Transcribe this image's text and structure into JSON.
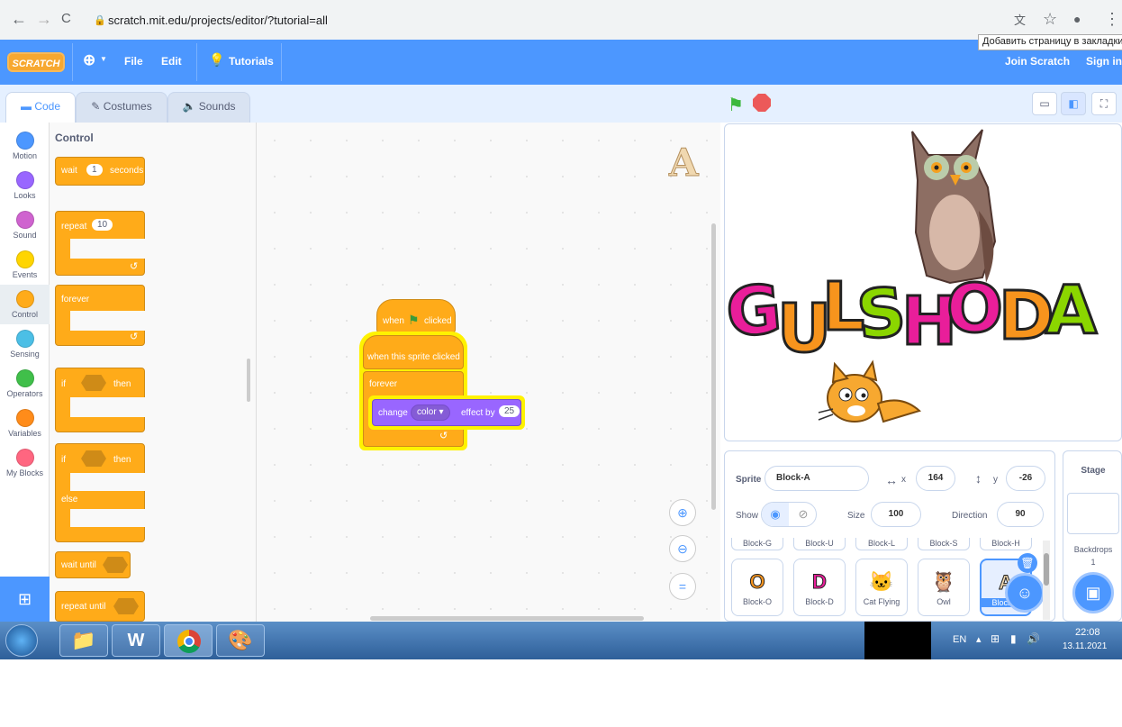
{
  "browser": {
    "url": "scratch.mit.edu/projects/editor/?tutorial=all",
    "tooltip": "Добавить страницу в закладки",
    "back_icon": "←",
    "forward_icon": "→",
    "reload_icon": "C"
  },
  "menubar": {
    "logo": "SCRATCH",
    "file": "File",
    "edit": "Edit",
    "tutorials": "Tutorials",
    "join": "Join Scratch",
    "signin": "Sign in"
  },
  "tabs": {
    "code": "Code",
    "costumes": "Costumes",
    "sounds": "Sounds"
  },
  "categories": [
    {
      "label": "Motion",
      "color": "#4c97ff"
    },
    {
      "label": "Looks",
      "color": "#9966ff"
    },
    {
      "label": "Sound",
      "color": "#cf63cf"
    },
    {
      "label": "Events",
      "color": "#ffd500"
    },
    {
      "label": "Control",
      "color": "#ffab19"
    },
    {
      "label": "Sensing",
      "color": "#4cbfe6"
    },
    {
      "label": "Operators",
      "color": "#40bf4a"
    },
    {
      "label": "Variables",
      "color": "#ff8c1a"
    },
    {
      "label": "My Blocks",
      "color": "#ff6680"
    }
  ],
  "palette": {
    "heading": "Control",
    "wait": "wait",
    "wait_value": "1",
    "seconds": "seconds",
    "repeat": "repeat",
    "repeat_value": "10",
    "forever": "forever",
    "if": "if",
    "then": "then",
    "if2": "if",
    "then2": "then",
    "else": "else",
    "wait_until": "wait until",
    "repeat_until": "repeat until"
  },
  "script": {
    "when": "when",
    "clicked": "clicked",
    "when_sprite_clicked": "when this sprite clicked",
    "forever": "forever",
    "change": "change",
    "effect_option": "color",
    "effect_by": "effect by",
    "effect_value": "25"
  },
  "stage": {
    "title_text": "GULSHODA"
  },
  "sprite_info": {
    "sprite_label": "Sprite",
    "sprite_name": "Block-A",
    "x_label": "x",
    "x_value": "164",
    "y_label": "y",
    "y_value": "-26",
    "show_label": "Show",
    "size_label": "Size",
    "size_value": "100",
    "direction_label": "Direction",
    "direction_value": "90"
  },
  "sprite_list_top": [
    "Block-G",
    "Block-U",
    "Block-L",
    "Block-S",
    "Block-H"
  ],
  "sprites": [
    {
      "name": "Block-O",
      "glyph": "O"
    },
    {
      "name": "Block-D",
      "glyph": "D"
    },
    {
      "name": "Cat Flying",
      "glyph": "🐱"
    },
    {
      "name": "Owl",
      "glyph": "🦉"
    },
    {
      "name": "Block-A",
      "glyph": "A"
    }
  ],
  "stage_pane": {
    "title": "Stage",
    "backdrops": "Backdrops",
    "backdrop_count": "1"
  },
  "taskbar": {
    "lang": "EN",
    "time": "22:08",
    "date": "13.11.2021"
  }
}
